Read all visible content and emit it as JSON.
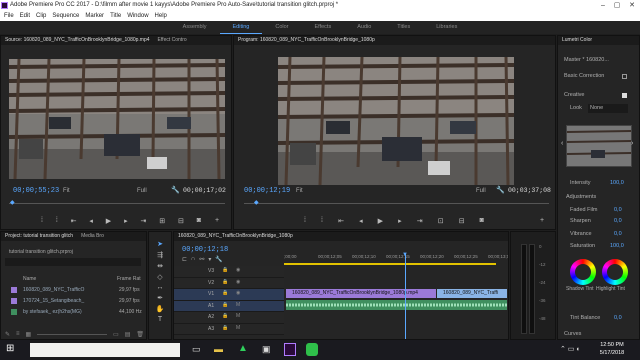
{
  "window": {
    "title": "Adobe Premiere Pro CC 2017 - D:\\filmm after movie 1 kayys\\Adobe Premiere Pro Auto-Save\\tutorial transition glitch.prproj *"
  },
  "menu": [
    "File",
    "Edit",
    "Clip",
    "Sequence",
    "Marker",
    "Title",
    "Window",
    "Help"
  ],
  "workspaces": [
    {
      "label": "Assembly",
      "active": false
    },
    {
      "label": "Editing",
      "active": true
    },
    {
      "label": "Color",
      "active": false
    },
    {
      "label": "Effects",
      "active": false
    },
    {
      "label": "Audio",
      "active": false
    },
    {
      "label": "Titles",
      "active": false
    },
    {
      "label": "Libraries",
      "active": false
    }
  ],
  "source": {
    "tab": "Source: 160820_089_NYC_TrafficOnBrooklynBridge_1080p.mp4",
    "tab2": "Effect Contro",
    "timecode": "00;00;55;23",
    "fit": "Fit",
    "quality": "Full",
    "duration": "00;00;17;02"
  },
  "program": {
    "tab": "Program: 160820_089_NYC_TrafficOnBrooklynBridge_1080p",
    "timecode": "00;00;12;19",
    "fit": "Fit",
    "quality": "Full",
    "duration": "00;03;37;08"
  },
  "project": {
    "tab": "Project: tutorial transition glitch",
    "tab2": "Media Bro",
    "file": "tutorial transition glitch.prproj",
    "col_name": "Name",
    "col_fps": "Frame Rat",
    "items": [
      {
        "name": "160820_089_NYC_TrafficO",
        "fps": "29,97 fps",
        "color": "#9b7ad8"
      },
      {
        "name": "170724_15_Setangibeach_",
        "fps": "29,97 fps",
        "color": "#9b7ad8"
      },
      {
        "name": "by stefsaek_ ez(h2hs(MG)",
        "fps": "44,100 Hz",
        "color": "#3f8f5f"
      }
    ]
  },
  "timeline": {
    "tab": "160820_089_NYC_TrafficOnBrooklynBridge_1080p",
    "timecode": "00;00;12;18",
    "ruler": [
      ";00;00",
      "00;00;12;05",
      "00;00;12;10",
      "00;00;12;15",
      "00;00;12;20",
      "00;00;12;25",
      "00;00;13;00"
    ],
    "tracks": [
      "V3",
      "V2",
      "V1",
      "A1",
      "A2",
      "A3"
    ],
    "clip1": "160820_089_NYC_TrafficOnBrooklynBridge_1080p.mp4",
    "clip2": "160820_089_NYC_Traffi",
    "meter_labels": [
      "0",
      "-12",
      "-24",
      "-36",
      "-48"
    ]
  },
  "lumetri": {
    "tab": "Lumetri Color",
    "master": "Master * 160820...",
    "basic": "Basic Correction",
    "creative": "Creative",
    "look_label": "Look",
    "look_value": "None",
    "intensity_label": "Intensity",
    "intensity": "100,0",
    "adjustments": "Adjustments",
    "faded_label": "Faded Film",
    "faded": "0,0",
    "sharpen_label": "Sharpen",
    "sharpen": "0,0",
    "vibrance_label": "Vibrance",
    "vibrance": "0,0",
    "saturation_label": "Saturation",
    "saturation": "100,0",
    "shadow_tint": "Shadow Tint",
    "highlight_tint": "Highlight Tint",
    "tint_balance_label": "Tint Balance",
    "tint_balance": "0,0",
    "curves": "Curves"
  },
  "taskbar": {
    "time": "12:50 PM",
    "date": "5/17/2018"
  }
}
